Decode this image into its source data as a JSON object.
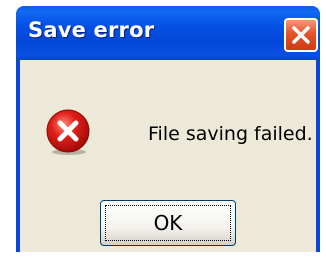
{
  "dialog": {
    "title": "Save error",
    "message": "File saving failed.",
    "ok_label": "OK",
    "close_icon": "close-icon",
    "status_icon": "error-icon"
  },
  "colors": {
    "titlebar": "#0552e6",
    "close_button": "#e5532a",
    "client_background": "#ece9d8",
    "error_icon": "#e0201a"
  }
}
